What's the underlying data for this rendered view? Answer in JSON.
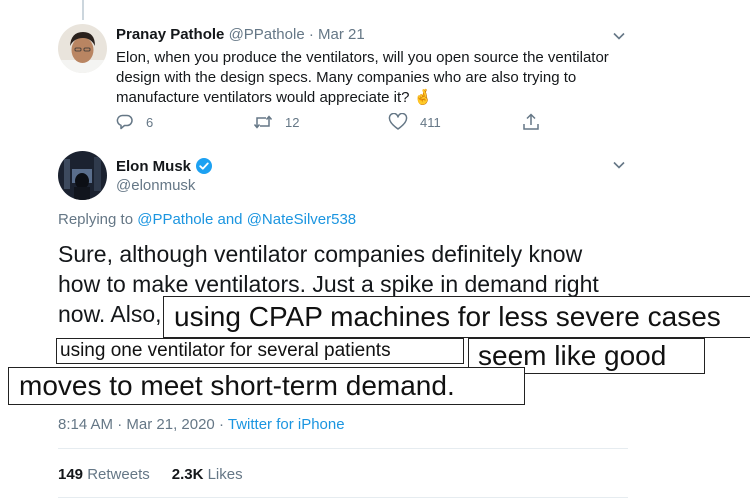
{
  "reply_tweet": {
    "author_name": "Pranay Pathole",
    "handle": "@PPathole",
    "separator": "·",
    "date": "Mar 21",
    "text": "Elon, when you produce the ventilators, will you open source the ventilator design with the design specs. Many companies who are also trying to manufacture ventilators would appreciate it? 🤞",
    "actions": {
      "replies": "6",
      "retweets": "12",
      "likes": "411"
    }
  },
  "main_tweet": {
    "author_name": "Elon Musk",
    "handle": "@elonmusk",
    "replying_prefix": "Replying to",
    "replying_user1": "@PPathole",
    "replying_and": "and",
    "replying_user2": "@NateSilver538",
    "line1": "Sure, although ventilator companies definitely know",
    "line2": "how to make ventilators. Just a spike in demand right",
    "line3_prefix": "now. Also,",
    "line4_text": "using one ventilator for several patients",
    "time": "8:14 AM",
    "meta_separator": "·",
    "date": "Mar 21, 2020",
    "source": "Twitter for iPhone",
    "retweets_count": "149",
    "retweets_label": "Retweets",
    "likes_count": "2.3K",
    "likes_label": "Likes"
  },
  "annotations": {
    "box1": "using CPAP machines for less severe cases",
    "box2": "seem like good",
    "box3": "moves to meet short-term demand."
  },
  "colors": {
    "link": "#1b95e0",
    "verified": "#1da1f2",
    "muted": "#657786"
  }
}
